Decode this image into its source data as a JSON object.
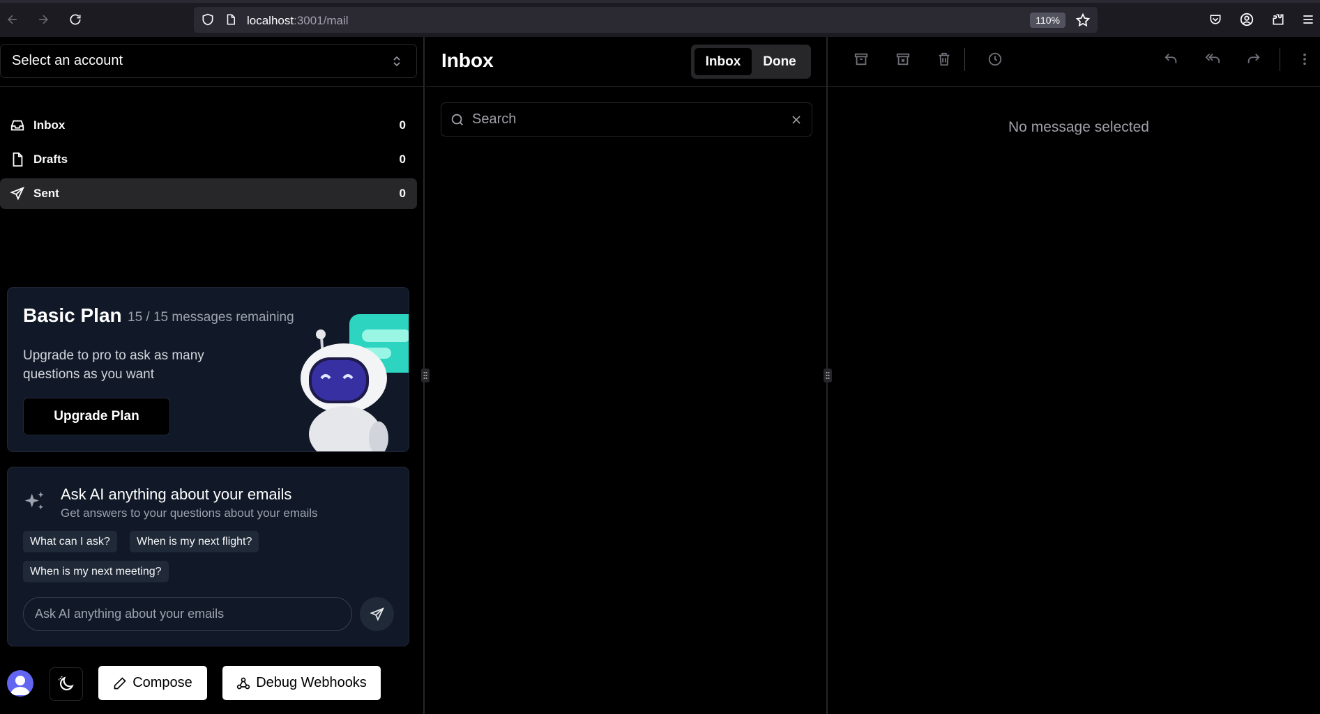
{
  "browser": {
    "url_host": "localhost",
    "url_path": ":3001/mail",
    "zoom": "110%",
    "icons": [
      "back-icon",
      "forward-icon",
      "reload-icon",
      "shield-icon",
      "page-icon",
      "star-icon",
      "pocket-icon",
      "account-icon",
      "extensions-icon",
      "menu-icon"
    ]
  },
  "sidebar": {
    "account_select": "Select an account",
    "nav": [
      {
        "label": "Inbox",
        "count": "0",
        "icon": "inbox-icon"
      },
      {
        "label": "Drafts",
        "count": "0",
        "icon": "file-icon"
      },
      {
        "label": "Sent",
        "count": "0",
        "icon": "send-icon",
        "active": true
      }
    ],
    "plan": {
      "title": "Basic Plan",
      "remaining": "15 / 15 messages remaining",
      "description": "Upgrade to pro to ask as many questions as you want",
      "button": "Upgrade Plan"
    },
    "ai": {
      "title": "Ask AI anything about your emails",
      "subtitle": "Get answers to your questions about your emails",
      "chips": [
        "What can I ask?",
        "When is my next flight?",
        "When is my next meeting?"
      ],
      "input_placeholder": "Ask AI anything about your emails"
    },
    "footer": {
      "compose": "Compose",
      "debug": "Debug Webhooks"
    }
  },
  "list": {
    "title": "Inbox",
    "tabs": [
      "Inbox",
      "Done"
    ],
    "active_tab": "Inbox",
    "search_placeholder": "Search"
  },
  "detail": {
    "empty_text": "No message selected",
    "toolbar_icons": [
      "archive-icon",
      "archive-x-icon",
      "trash-icon",
      "clock-icon",
      "reply-icon",
      "reply-all-icon",
      "forward-icon",
      "more-vertical-icon"
    ]
  },
  "colors": {
    "background": "#000000",
    "card": "#111827",
    "border": "#27272a",
    "accent_robot": "#2dd4bf"
  }
}
